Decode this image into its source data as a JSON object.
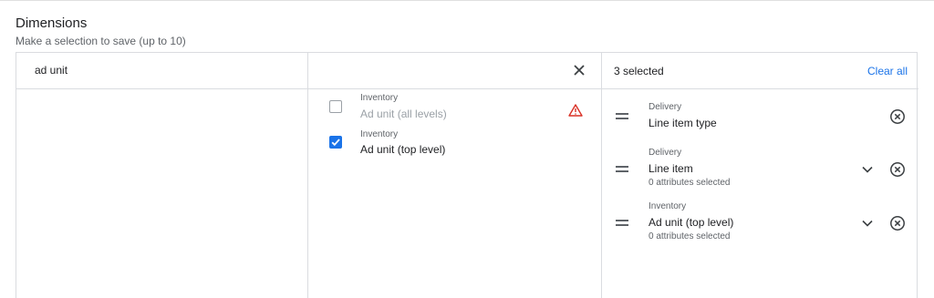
{
  "header": {
    "title": "Dimensions",
    "subtitle": "Make a selection to save (up to 10)"
  },
  "search": {
    "value": "ad unit",
    "clear_icon": "close-icon"
  },
  "results": [
    {
      "category": "Inventory",
      "label": "Ad unit (all levels)",
      "checked": false,
      "disabled": true,
      "warning": true
    },
    {
      "category": "Inventory",
      "label": "Ad unit (top level)",
      "checked": true,
      "disabled": false,
      "warning": false
    }
  ],
  "selection": {
    "count_label": "3 selected",
    "clear_all_label": "Clear all",
    "items": [
      {
        "category": "Delivery",
        "label": "Line item type",
        "sublabel": "",
        "expandable": false
      },
      {
        "category": "Delivery",
        "label": "Line item",
        "sublabel": "0 attributes selected",
        "expandable": true
      },
      {
        "category": "Inventory",
        "label": "Ad unit (top level)",
        "sublabel": "0 attributes selected",
        "expandable": true
      }
    ]
  },
  "colors": {
    "accent": "#1a73e8",
    "warning": "#d93025",
    "border": "#dadce0"
  }
}
